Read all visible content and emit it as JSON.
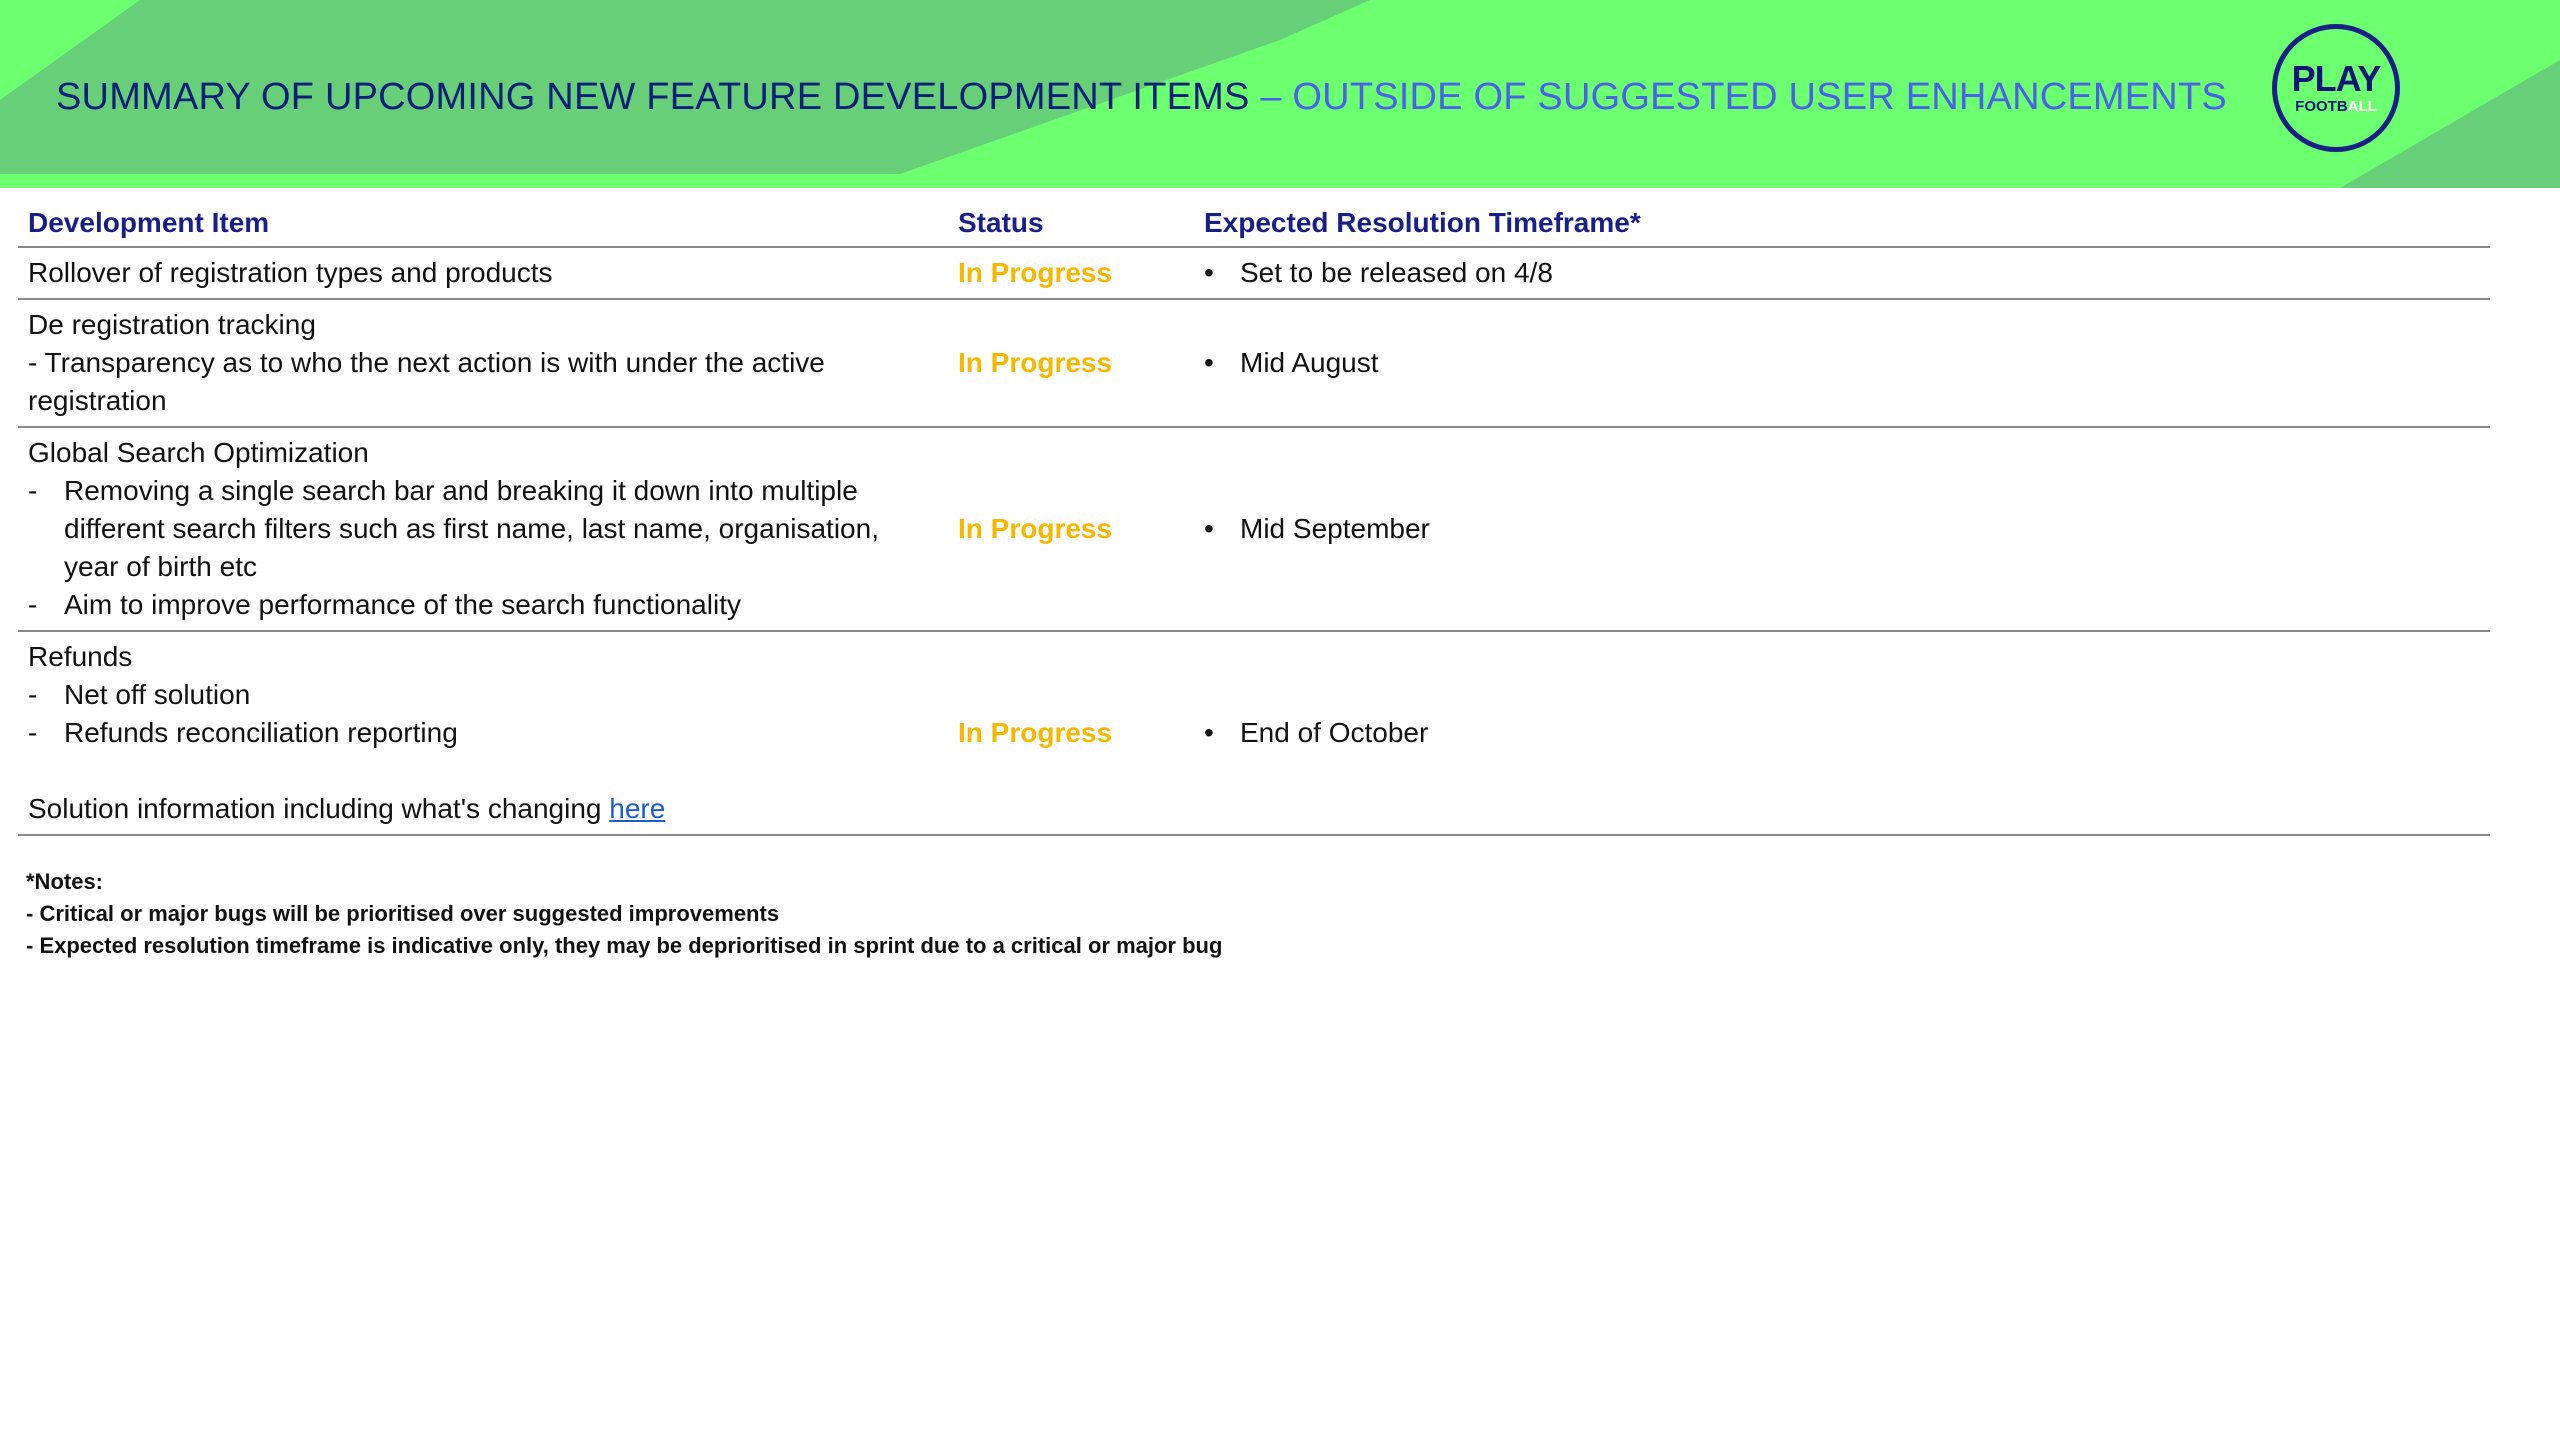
{
  "header": {
    "title_main": "SUMMARY OF UPCOMING NEW FEATURE DEVELOPMENT ITEMS",
    "title_sub": "– OUTSIDE OF SUGGESTED USER ENHANCEMENTS",
    "logo_top": "PLAY",
    "logo_bottom_a": "FOOTB",
    "logo_bottom_b": "ALL"
  },
  "colors": {
    "banner": "#6cff70",
    "title_main": "#0b1f7a",
    "title_sub": "#4a62e8",
    "header_text": "#1a1f86",
    "status": "#f5b800",
    "link": "#1a5dcc"
  },
  "table": {
    "headers": [
      "Development Item",
      "Status",
      "Expected Resolution Timeframe*"
    ],
    "rows": [
      {
        "title": "Rollover of registration types and products",
        "status": "In Progress",
        "timeframe": "Set to be released on 4/8"
      },
      {
        "title": "De registration tracking",
        "desc": "- Transparency as to who the next action is with under the active registration",
        "status": "In Progress",
        "timeframe": "Mid August"
      },
      {
        "title": "Global Search Optimization",
        "points": [
          "Removing a single search bar and breaking it down into multiple different search filters such as first name, last name, organisation, year of birth etc",
          "Aim to improve performance of the search functionality"
        ],
        "status": "In Progress",
        "timeframe": "Mid September"
      },
      {
        "title": "Refunds",
        "points": [
          "Net off solution",
          "Refunds reconciliation reporting"
        ],
        "extra_text": "Solution information including what's changing",
        "link_text": "here",
        "status": "In Progress",
        "timeframe": "End of October"
      }
    ]
  },
  "notes": {
    "heading": "*Notes:",
    "lines": [
      "- Critical or major bugs will be prioritised over suggested improvements",
      "- Expected resolution timeframe is indicative only, they may be deprioritised in sprint due to a critical or major bug"
    ]
  },
  "symbols": {
    "bullet": "•",
    "dash": "-"
  }
}
